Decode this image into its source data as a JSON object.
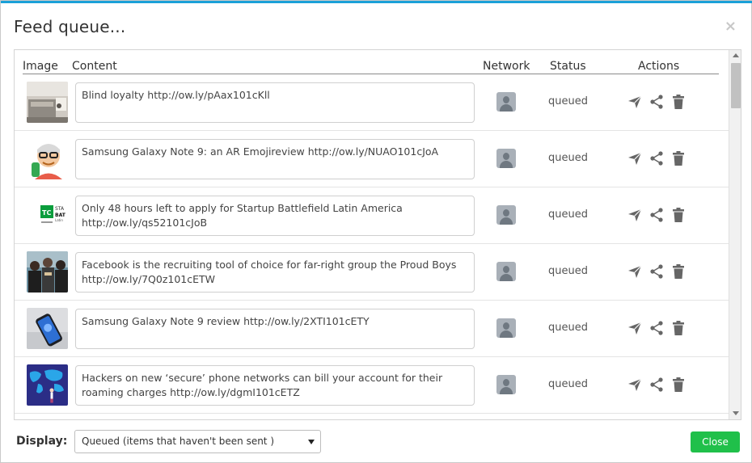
{
  "dialog": {
    "title": "Feed queue...",
    "close_glyph": "×"
  },
  "table": {
    "headers": {
      "image": "Image",
      "content": "Content",
      "network": "Network",
      "status": "Status",
      "actions": "Actions"
    },
    "rows": [
      {
        "content": "Blind loyalty http://ow.ly/pAax101cKll",
        "status": "queued",
        "thumb": "office-photo",
        "network_icon": "user-avatar-icon"
      },
      {
        "content": "Samsung Galaxy Note 9: an AR Emojireview http://ow.ly/NUAO101cJoA",
        "status": "queued",
        "thumb": "emoji-avatar-photo",
        "network_icon": "user-avatar-icon"
      },
      {
        "content": "Only 48 hours left to apply for Startup Battlefield Latin America http://ow.ly/qs52101cJoB",
        "status": "queued",
        "thumb": "techcrunch-logo",
        "network_icon": "user-avatar-icon"
      },
      {
        "content": "Facebook is the recruiting tool of choice for far-right group the Proud Boys http://ow.ly/7Q0z101cETW",
        "status": "queued",
        "thumb": "crowd-photo",
        "network_icon": "user-avatar-icon"
      },
      {
        "content": "Samsung Galaxy Note 9 review http://ow.ly/2XTI101cETY",
        "status": "queued",
        "thumb": "phone-photo",
        "network_icon": "user-avatar-icon"
      },
      {
        "content": "Hackers on new ‘secure’ phone networks can bill your account for their roaming charges http://ow.ly/dgmI101cETZ",
        "status": "queued",
        "thumb": "world-map-illustration",
        "network_icon": "user-avatar-icon"
      }
    ],
    "action_icons": [
      "send-icon",
      "share-icon",
      "trash-icon"
    ]
  },
  "footer": {
    "display_label": "Display:",
    "display_selected": "Queued (items that haven't been sent )",
    "close_label": "Close"
  },
  "colors": {
    "accent": "#1aa0d8",
    "close_button": "#20c04a",
    "icon": "#666666"
  }
}
